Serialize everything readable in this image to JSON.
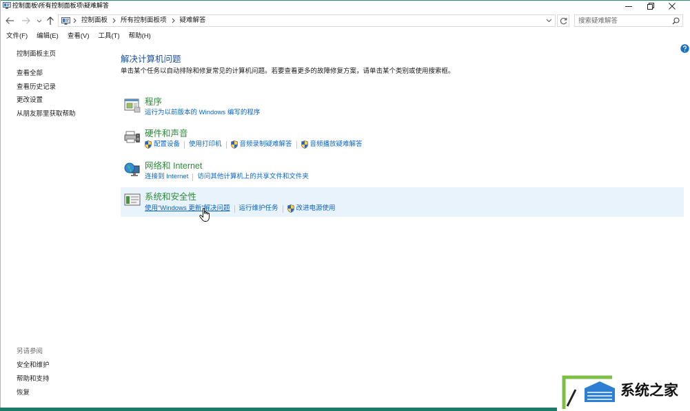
{
  "window": {
    "title": "控制面板\\所有控制面板项\\疑难解答"
  },
  "nav": {
    "address_segments": [
      "控制面板",
      "所有控制面板项",
      "疑难解答"
    ],
    "search_placeholder": "搜索疑难解答"
  },
  "menu": [
    "文件(F)",
    "编辑(E)",
    "查看(V)",
    "工具(T)",
    "帮助(H)"
  ],
  "sidebar": {
    "home": "控制面板主页",
    "links": [
      "查看全部",
      "查看历史记录",
      "更改设置",
      "从朋友那里获取帮助"
    ],
    "see_also_heading": "另请参阅",
    "see_also": [
      "安全和维护",
      "帮助和支持",
      "恢复"
    ]
  },
  "main": {
    "title": "解决计算机问题",
    "description": "单击某个任务以自动排除和修复常见的计算机问题。若要查看更多的故障修复方案，请单击某个类别或使用搜索框。",
    "categories": [
      {
        "title": "程序",
        "icon": "programs-icon",
        "links": [
          {
            "label": "运行为以前版本的 Windows 编写的程序"
          }
        ]
      },
      {
        "title": "硬件和声音",
        "icon": "hardware-sound-icon",
        "links": [
          {
            "label": "配置设备",
            "icon": "shield-icon"
          },
          {
            "label": "使用打印机"
          },
          {
            "label": "音频录制疑难解答",
            "icon": "shield-icon"
          },
          {
            "label": "音频播放疑难解答",
            "icon": "shield-icon"
          }
        ]
      },
      {
        "title": "网络和 Internet",
        "icon": "network-internet-icon",
        "links": [
          {
            "label": "连接到 Internet"
          },
          {
            "label": "访问其他计算机上的共享文件和文件夹"
          }
        ]
      },
      {
        "title": "系统和安全性",
        "icon": "system-security-icon",
        "highlighted": true,
        "links": [
          {
            "label": "使用“Windows 更新”解决问题",
            "hovered": true
          },
          {
            "label": "运行维护任务"
          },
          {
            "label": "改进电源使用",
            "icon": "shield-icon"
          }
        ]
      }
    ]
  },
  "colors": {
    "accent": "#2a8c6e",
    "heading": "#1c4fa0",
    "category_title": "#2d8a3a",
    "link": "#0a64c8",
    "highlight_bg": "#e8f3fb",
    "help_icon": "#1e6fc0",
    "bottom_strip": "#1c7a68"
  },
  "watermark": {
    "text": "系统之家"
  }
}
